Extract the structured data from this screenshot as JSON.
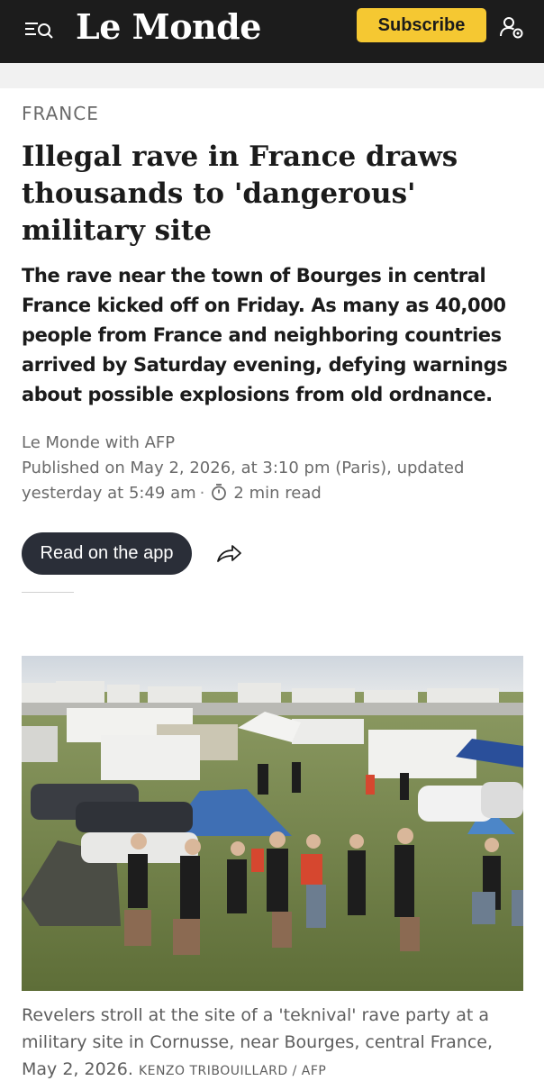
{
  "header": {
    "logo": "Le Monde",
    "subscribe_label": "Subscribe",
    "menu_icon": "menu-search-icon",
    "account_icon": "account-settings-icon",
    "brand_color": "#1c1c1c",
    "accent_color": "#f5c832"
  },
  "article": {
    "section": "FRANCE",
    "headline": "Illegal rave in France draws thousands to 'dangerous' military site",
    "deck": "The rave near the town of Bourges in central France kicked off on Friday. As many as 40,000 people from France and neighboring countries arrived by Saturday evening, defying warnings about possible explosions from old ordnance.",
    "author": "Le Monde with AFP",
    "published": "Published on May 2, 2026, at 3:10 pm (Paris), updated yesterday at 5:49 am",
    "read_time": "2 min read",
    "read_app_label": "Read on the app",
    "share_icon": "share-icon",
    "timer_icon": "stopwatch-icon"
  },
  "photo": {
    "caption": "Revelers stroll at the site of a 'teknival' rave party at a military site in Cornusse, near Bourges, central France, May 2, 2026.",
    "credit": "KENZO TRIBOUILLARD / AFP"
  }
}
